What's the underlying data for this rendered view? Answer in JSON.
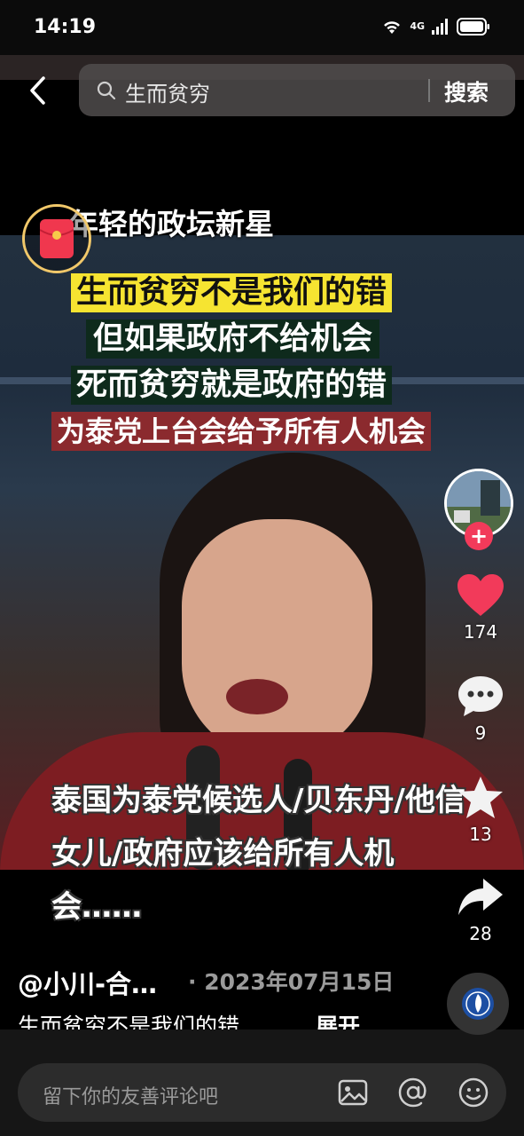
{
  "status_bar": {
    "time": "14:19",
    "network": "4G",
    "icons": [
      "wifi-icon",
      "signal-icon",
      "battery-icon"
    ]
  },
  "search": {
    "query": "生而贫穷",
    "button_label": "搜索"
  },
  "video": {
    "header_text": "年轻的政坛新星",
    "captions": [
      "生而贫穷不是我们的错",
      "但如果政府不给机会",
      "死而贫穷就是政府的错",
      "为泰党上台会给予所有人机会"
    ],
    "caption_colors": [
      "#f6e431",
      "#0e2a1c",
      "#0e2a1c",
      "#8b2a2e"
    ],
    "subtitle": "泰国为泰党候选人/贝东丹/他信女儿/政府应该给所有人机会……"
  },
  "actions": {
    "likes": "174",
    "comments": "9",
    "favorites": "13",
    "shares": "28",
    "like_color": "#f23a5a"
  },
  "post": {
    "author": "@小川-合…",
    "date": "· 2023年07月15日",
    "description": "生而贫穷不是我们的错…",
    "expand_label": "展开"
  },
  "comment_bar": {
    "placeholder": "留下你的友善评论吧"
  }
}
